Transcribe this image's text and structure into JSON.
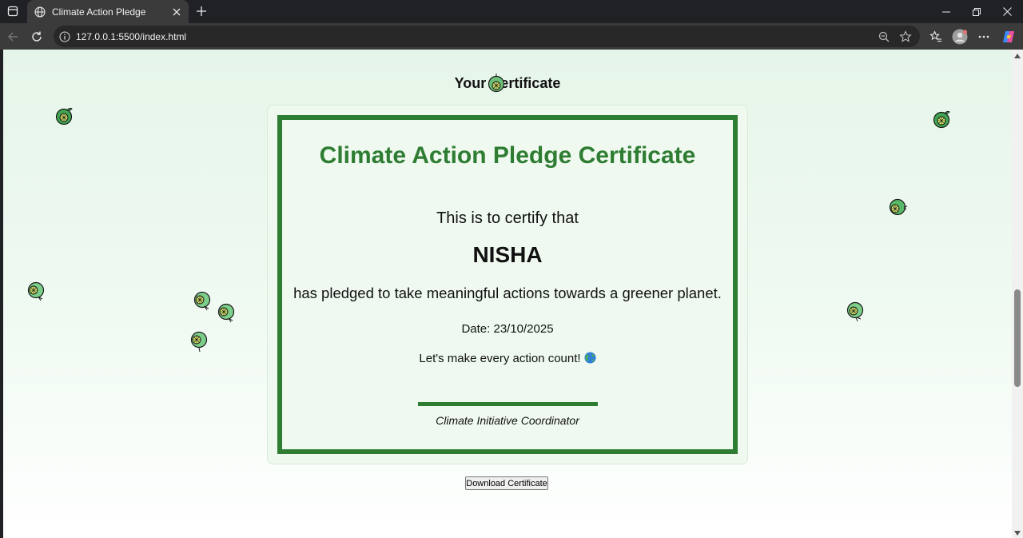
{
  "browser": {
    "tab_title": "Climate Action Pledge",
    "url": "127.0.0.1:5500/index.html"
  },
  "page": {
    "heading": "Your Certificate",
    "certificate": {
      "title": "Climate Action Pledge Certificate",
      "certify_text": "This is to certify that",
      "name": "NISHA",
      "pledge_text": "has pledged to take meaningful actions towards a greener planet.",
      "date": "Date: 23/10/2025",
      "cta": "Let's make every action count!",
      "signature_role": "Climate Initiative Coordinator"
    },
    "download_label": "Download Certificate"
  },
  "colors": {
    "accent_green": "#2e7d32",
    "lime_fill": "#7ccf8a"
  }
}
